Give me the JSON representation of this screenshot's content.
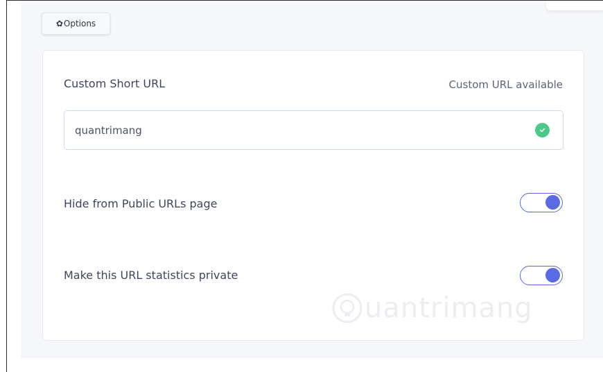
{
  "options_button": {
    "icon": "gear-icon",
    "label": "Options"
  },
  "custom_url": {
    "label": "Custom Short URL",
    "status": "Custom URL available",
    "value": "quantrimang",
    "status_icon": "check-icon",
    "status_color": "#4cc98a"
  },
  "toggles": [
    {
      "label": "Hide from Public URLs page",
      "on": true
    },
    {
      "label": "Make this URL statistics private",
      "on": true
    }
  ],
  "accent_color": "#5a6ae2",
  "watermark": {
    "text": "uantrimang",
    "icon": "bulb-logo-icon"
  }
}
